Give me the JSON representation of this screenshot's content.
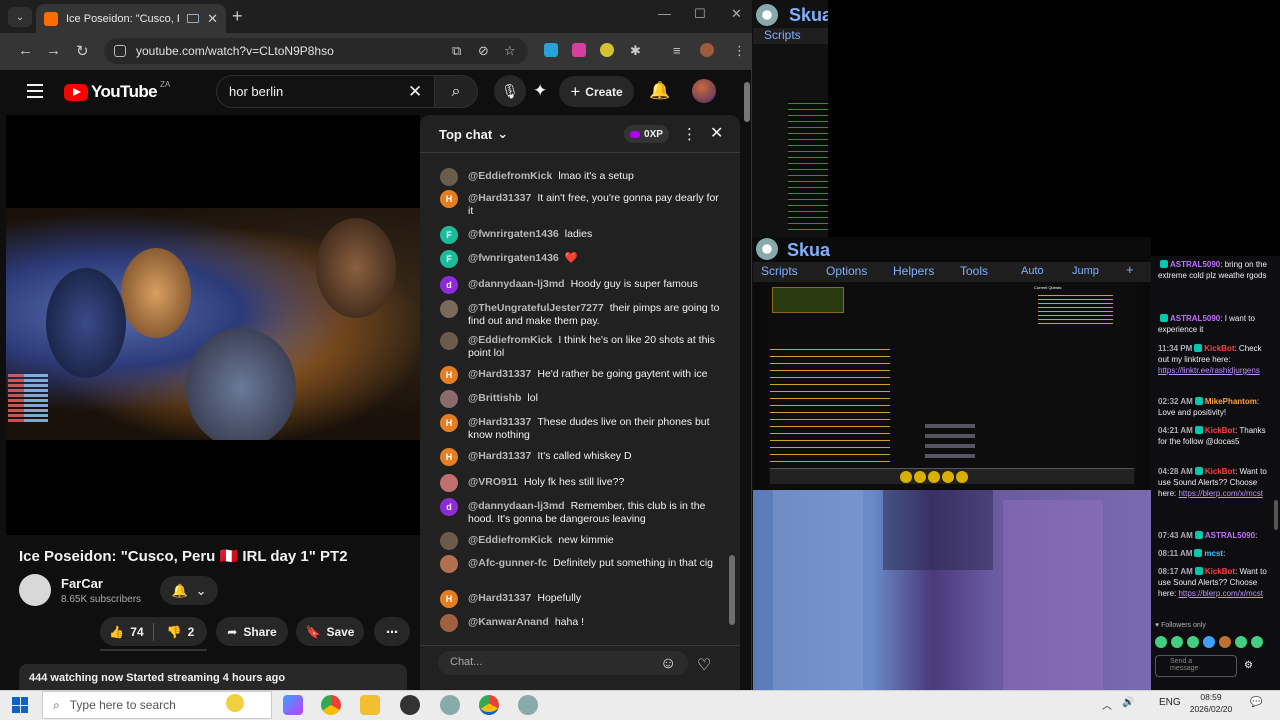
{
  "browser": {
    "tab_title": "Ice Poseidon: \"Cusco, Peru",
    "url": "youtube.com/watch?v=CLtoN9P8hso"
  },
  "youtube": {
    "logo_text": "YouTube",
    "logo_region": "ZA",
    "search_query": "hor berlin",
    "create_label": "Create",
    "video_title": "Ice Poseidon: \"Cusco, Peru 🇵🇪 IRL day 1\" PT2",
    "channel_name": "FarCar",
    "subscribers": "8.65K subscribers",
    "likes": "74",
    "dislikes": "2",
    "share_label": "Share",
    "save_label": "Save",
    "description": "444 watching now  Started streaming 4 hours ago"
  },
  "live_chat": {
    "title": "Top chat",
    "xp_label": "0XP",
    "input_placeholder": "Chat...",
    "messages": [
      {
        "author": "@EddiefromKick",
        "text": "lmao it's a setup",
        "avatar_color": "#6b5b4b",
        "initial": ""
      },
      {
        "author": "@Hard31337",
        "text": "It ain't free, you're gonna pay dearly for it",
        "avatar_color": "#e67e22",
        "initial": "H"
      },
      {
        "author": "@fwnrirgaten1436",
        "text": "ladies",
        "avatar_color": "#1abc9c",
        "initial": "F"
      },
      {
        "author": "@fwnrirgaten1436",
        "text": "❤️",
        "avatar_color": "#1abc9c",
        "initial": "F"
      },
      {
        "author": "@dannydaan-lj3md",
        "text": "Hoody guy is super famous",
        "avatar_color": "#8e2bd8",
        "initial": "d"
      },
      {
        "author": "@TheUngratefulJester7277",
        "text": "their pimps are going to find out and make them pay.",
        "avatar_color": "#7a6a5a",
        "initial": ""
      },
      {
        "author": "@EddiefromKick",
        "text": "I think he's on like 20 shots at this point lol",
        "avatar_color": "#6b5b4b",
        "initial": ""
      },
      {
        "author": "@Hard31337",
        "text": "He'd rather be going gaytent with ice",
        "avatar_color": "#e67e22",
        "initial": "H"
      },
      {
        "author": "@Brittishb",
        "text": "lol",
        "avatar_color": "#8a6a6a",
        "initial": ""
      },
      {
        "author": "@Hard31337",
        "text": "These dudes live on their phones but know nothing",
        "avatar_color": "#e67e22",
        "initial": "H"
      },
      {
        "author": "@Hard31337",
        "text": "It's called whiskey D",
        "avatar_color": "#e67e22",
        "initial": "H"
      },
      {
        "author": "@VRO911",
        "text": "Holy fk hes still live??",
        "avatar_color": "#c07070",
        "initial": ""
      },
      {
        "author": "@dannydaan-lj3md",
        "text": "Remember, this club is in the hood. It's gonna be dangerous leaving",
        "avatar_color": "#8e2bd8",
        "initial": "d"
      },
      {
        "author": "@EddiefromKick",
        "text": "new kimmie",
        "avatar_color": "#6b5b4b",
        "initial": ""
      },
      {
        "author": "@Afc-gunner-fc",
        "text": "Definitely put something in that cig",
        "avatar_color": "#b07050",
        "initial": ""
      },
      {
        "author": "@Hard31337",
        "text": "Hopefully",
        "avatar_color": "#e67e22",
        "initial": "H"
      },
      {
        "author": "@KanwarAnand",
        "text": "haha !",
        "avatar_color": "#a06040",
        "initial": ""
      }
    ]
  },
  "skua": {
    "title": "Skua",
    "menu": [
      "Scripts",
      "Options",
      "Helpers",
      "Tools",
      "Auto",
      "Jump"
    ],
    "quests_header": "Current Quests:"
  },
  "twitch_chat": {
    "messages": [
      {
        "time": "",
        "name": "ASTRAL5090",
        "name_color": "#c070ff",
        "text": ": bring on the extreme cold plz weathe rgods",
        "link": ""
      },
      {
        "time": "",
        "name": "ASTRAL5090",
        "name_color": "#c070ff",
        "text": ": I want to experience it",
        "link": ""
      },
      {
        "time": "11:34 PM",
        "name": "KickBot",
        "name_color": "#ff4040",
        "text": ": Check out my linktree here: ",
        "link": "https://linktr.ee/rashidjurgens"
      },
      {
        "time": "02:32 AM",
        "name": "MikePhantom",
        "name_color": "#ffa040",
        "text": ": Love and positivity!",
        "link": ""
      },
      {
        "time": "04:21 AM",
        "name": "KickBot",
        "name_color": "#ff4040",
        "text": ": Thanks for the follow @docas5",
        "link": ""
      },
      {
        "time": "04:28 AM",
        "name": "KickBot",
        "name_color": "#ff4040",
        "text": ": Want to use Sound Alerts?? Choose here: ",
        "link": "https://blerp.com/x/mcst"
      },
      {
        "time": "07:43 AM",
        "name": "ASTRAL5090",
        "name_color": "#c070ff",
        "text": ":",
        "link": ""
      },
      {
        "time": "08:11 AM",
        "name": "mcst",
        "name_color": "#40c0ff",
        "text": ":",
        "link": ""
      },
      {
        "time": "08:17 AM",
        "name": "KickBot",
        "name_color": "#ff4040",
        "text": ": Want to use Sound Alerts?? Choose here: ",
        "link": "https://blerp.com/x/mcst"
      }
    ],
    "followers_only": "Followers only",
    "input_placeholder": "Send a message"
  },
  "taskbar": {
    "search_placeholder": "Type here to search",
    "lang": "ENG",
    "time": "08:59",
    "date": "2026/02/20"
  }
}
